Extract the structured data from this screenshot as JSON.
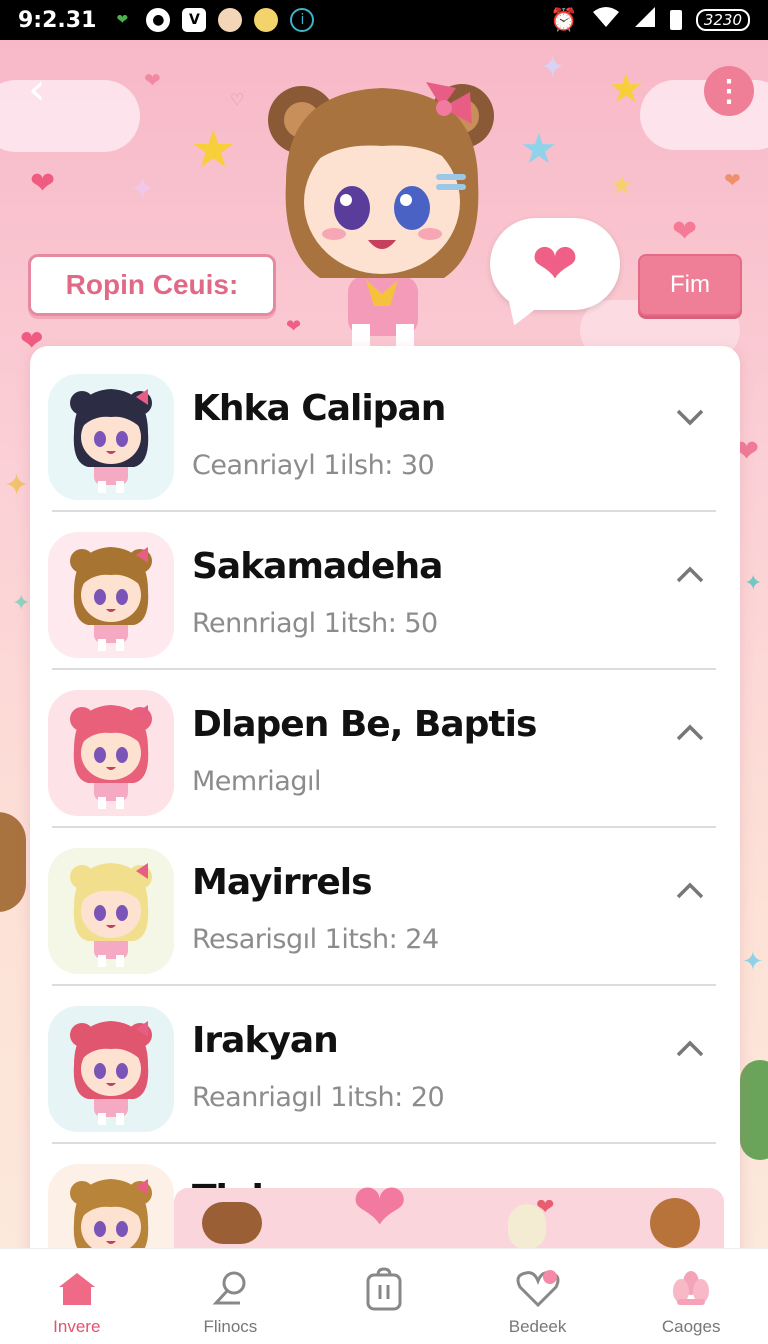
{
  "status_bar": {
    "time": "9:2.31",
    "battery": "3230"
  },
  "header": {
    "title": "Ropin Ceuis:",
    "action_button": "Fim"
  },
  "list": [
    {
      "name": "Khka Calipan",
      "subtitle": "Ceanriayl 1ilsh: 30",
      "chevron": "down",
      "avatar_bg": "#e9f6f8",
      "hair": "#2c2c44"
    },
    {
      "name": "Sakamadeha",
      "subtitle": "Rennriagl 1itsh: 50",
      "chevron": "up",
      "avatar_bg": "#fde9ee",
      "hair": "#a87432"
    },
    {
      "name": "Dlapen Be, Baptis",
      "subtitle": "Memriagıl",
      "chevron": "up",
      "avatar_bg": "#fde2e8",
      "hair": "#e8607a"
    },
    {
      "name": "Mayirrels",
      "subtitle": "Resarisgıl 1itsh: 24",
      "chevron": "up",
      "avatar_bg": "#f4f6e6",
      "hair": "#f2df8e"
    },
    {
      "name": "Irakyan",
      "subtitle": "Reanriagıl 1itsh: 20",
      "chevron": "up",
      "avatar_bg": "#e7f4f6",
      "hair": "#e0566e"
    },
    {
      "name": "Tinlonno",
      "subtitle": "",
      "chevron": "",
      "avatar_bg": "#fdf0e6",
      "hair": "#b8843a"
    }
  ],
  "bottom_nav": [
    {
      "label": "Invere",
      "icon": "home-icon",
      "active": true
    },
    {
      "label": "Flinocs",
      "icon": "search-icon",
      "active": false
    },
    {
      "label": "",
      "icon": "bag-icon",
      "active": false
    },
    {
      "label": "Bedeek",
      "icon": "heart-icon",
      "active": false
    },
    {
      "label": "Caoges",
      "icon": "flower-icon",
      "active": false
    }
  ],
  "colors": {
    "accent": "#ef7f97",
    "title_text": "#e06a86",
    "active_nav": "#e0546f"
  }
}
